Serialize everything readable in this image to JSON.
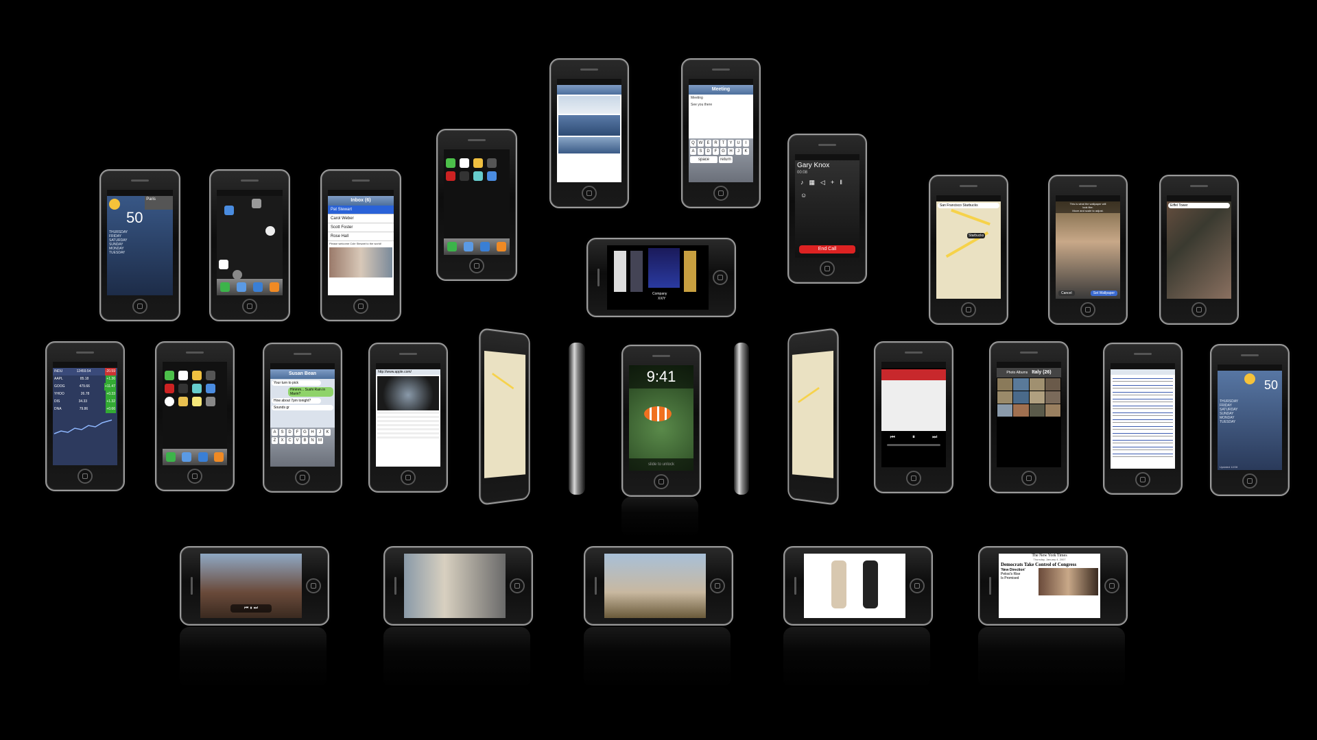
{
  "weather": {
    "temp": "50",
    "city": "Paris",
    "days": [
      "THURSDAY",
      "FRIDAY",
      "SATURDAY",
      "SUNDAY",
      "MONDAY",
      "TUESDAY"
    ],
    "highs": [
      "56°",
      "56°",
      "56°",
      "56°",
      "56°",
      "56°"
    ],
    "updated": "Updated 12/28"
  },
  "mail": {
    "header": "Inbox (6)",
    "senders": [
      "Pat Stewart",
      "Carol Weber",
      "Scott Foster",
      "Rose Hall"
    ],
    "preview": "Please welcome Cole Stewart to the world!"
  },
  "compose": {
    "title": "Meeting",
    "subject": "Meeting",
    "body": "See you there",
    "space": "space",
    "return": "return"
  },
  "call": {
    "name": "Gary Knox",
    "duration": "00:08",
    "end_label": "End Call"
  },
  "maps_search": "San Francisco Starbucks",
  "map_pin": "Starbucks",
  "wallpaper": {
    "instruction_line1": "This is what the wallpaper will",
    "instruction_line2": "look like.",
    "instruction_line3": "Move and scale to adjust.",
    "cancel": "Cancel",
    "set": "Set Wallpaper"
  },
  "maps_search2": "Eiffel Tower",
  "stocks": {
    "rows": [
      {
        "sym": "INDU",
        "price": "12459.54",
        "chg": "-20.59"
      },
      {
        "sym": "AAPL",
        "price": "85.18",
        "chg": "+1.36"
      },
      {
        "sym": "GOOG",
        "price": "479.66",
        "chg": "+11.47"
      },
      {
        "sym": "YHOO",
        "price": "26.78",
        "chg": "+0.33"
      },
      {
        "sym": "DIS",
        "price": "34.33",
        "chg": "+1.32"
      },
      {
        "sym": "DNA",
        "price": "79.86",
        "chg": "+0.66"
      }
    ]
  },
  "sms": {
    "contact": "Susan Bean",
    "msgs": [
      "Your turn to pick",
      "Hmmm... Sushi Rain in Marin?",
      "How about 7pm tonight?",
      "Sounds gr"
    ],
    "send": "Send"
  },
  "browser_url": "http://www.apple.com/",
  "lock": {
    "time": "9:41",
    "slide": "slide to unlock"
  },
  "coverflow": {
    "artist": "Company",
    "album": "XX/Y"
  },
  "photos": {
    "album": "Italy (26)",
    "back": "Photo Albums"
  },
  "nyt": {
    "masthead": "The New York Times",
    "date": "Thursday, January 4, 2007",
    "headline": "Democrats Take Control of Congress",
    "sub1": "'New Direction'",
    "sub2": "Pelosi's Rise",
    "sub3": "Is Promised"
  }
}
